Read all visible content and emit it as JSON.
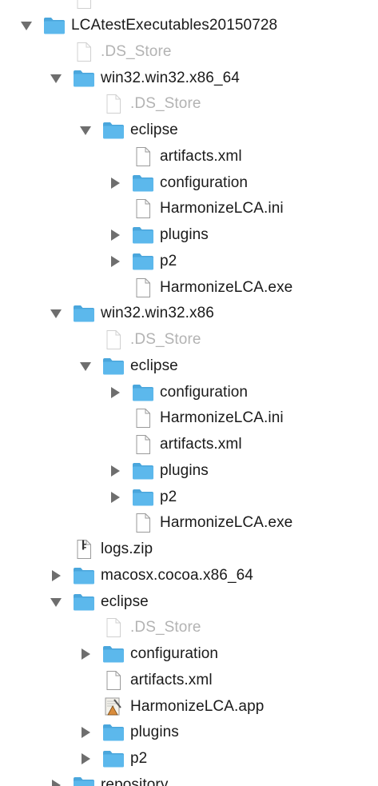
{
  "colors": {
    "folder_body": "#5cb8ec",
    "folder_tab": "#4aa6dc",
    "text": "#1a1a1a",
    "text_dim": "#b3b3b3",
    "triangle": "#6e6e6e"
  },
  "rows": [
    {
      "label": "",
      "level": 1,
      "kind": "file",
      "arrow": "none",
      "dim": true,
      "cut": true
    },
    {
      "label": "LCAtestExecutables20150728",
      "level": 0,
      "kind": "folder",
      "arrow": "down",
      "dim": false
    },
    {
      "label": ".DS_Store",
      "level": 1,
      "kind": "file",
      "arrow": "none",
      "dim": true
    },
    {
      "label": "win32.win32.x86_64",
      "level": 1,
      "kind": "folder",
      "arrow": "down",
      "dim": false
    },
    {
      "label": ".DS_Store",
      "level": 2,
      "kind": "file",
      "arrow": "none",
      "dim": true
    },
    {
      "label": "eclipse",
      "level": 2,
      "kind": "folder",
      "arrow": "down",
      "dim": false
    },
    {
      "label": "artifacts.xml",
      "level": 3,
      "kind": "file",
      "arrow": "none",
      "dim": false
    },
    {
      "label": "configuration",
      "level": 3,
      "kind": "folder",
      "arrow": "right",
      "dim": false
    },
    {
      "label": "HarmonizeLCA.ini",
      "level": 3,
      "kind": "file",
      "arrow": "none",
      "dim": false
    },
    {
      "label": "plugins",
      "level": 3,
      "kind": "folder",
      "arrow": "right",
      "dim": false
    },
    {
      "label": "p2",
      "level": 3,
      "kind": "folder",
      "arrow": "right",
      "dim": false
    },
    {
      "label": "HarmonizeLCA.exe",
      "level": 3,
      "kind": "file",
      "arrow": "none",
      "dim": false
    },
    {
      "label": "win32.win32.x86",
      "level": 1,
      "kind": "folder",
      "arrow": "down",
      "dim": false
    },
    {
      "label": ".DS_Store",
      "level": 2,
      "kind": "file",
      "arrow": "none",
      "dim": true
    },
    {
      "label": "eclipse",
      "level": 2,
      "kind": "folder",
      "arrow": "down",
      "dim": false
    },
    {
      "label": "configuration",
      "level": 3,
      "kind": "folder",
      "arrow": "right",
      "dim": false
    },
    {
      "label": "HarmonizeLCA.ini",
      "level": 3,
      "kind": "file",
      "arrow": "none",
      "dim": false
    },
    {
      "label": "artifacts.xml",
      "level": 3,
      "kind": "file",
      "arrow": "none",
      "dim": false
    },
    {
      "label": "plugins",
      "level": 3,
      "kind": "folder",
      "arrow": "right",
      "dim": false
    },
    {
      "label": "p2",
      "level": 3,
      "kind": "folder",
      "arrow": "right",
      "dim": false
    },
    {
      "label": "HarmonizeLCA.exe",
      "level": 3,
      "kind": "file",
      "arrow": "none",
      "dim": false
    },
    {
      "label": "logs.zip",
      "level": 1,
      "kind": "zip",
      "arrow": "none",
      "dim": false
    },
    {
      "label": "macosx.cocoa.x86_64",
      "level": 1,
      "kind": "folder",
      "arrow": "right",
      "dim": false
    },
    {
      "label": "eclipse",
      "level": 1,
      "kind": "folder",
      "arrow": "down",
      "dim": false
    },
    {
      "label": ".DS_Store",
      "level": 2,
      "kind": "file",
      "arrow": "none",
      "dim": true
    },
    {
      "label": "configuration",
      "level": 2,
      "kind": "folder",
      "arrow": "right",
      "dim": false
    },
    {
      "label": "artifacts.xml",
      "level": 2,
      "kind": "file",
      "arrow": "none",
      "dim": false
    },
    {
      "label": "HarmonizeLCA.app",
      "level": 2,
      "kind": "app",
      "arrow": "none",
      "dim": false
    },
    {
      "label": "plugins",
      "level": 2,
      "kind": "folder",
      "arrow": "right",
      "dim": false
    },
    {
      "label": "p2",
      "level": 2,
      "kind": "folder",
      "arrow": "right",
      "dim": false
    },
    {
      "label": "repository",
      "level": 1,
      "kind": "folder",
      "arrow": "right",
      "dim": false
    }
  ]
}
